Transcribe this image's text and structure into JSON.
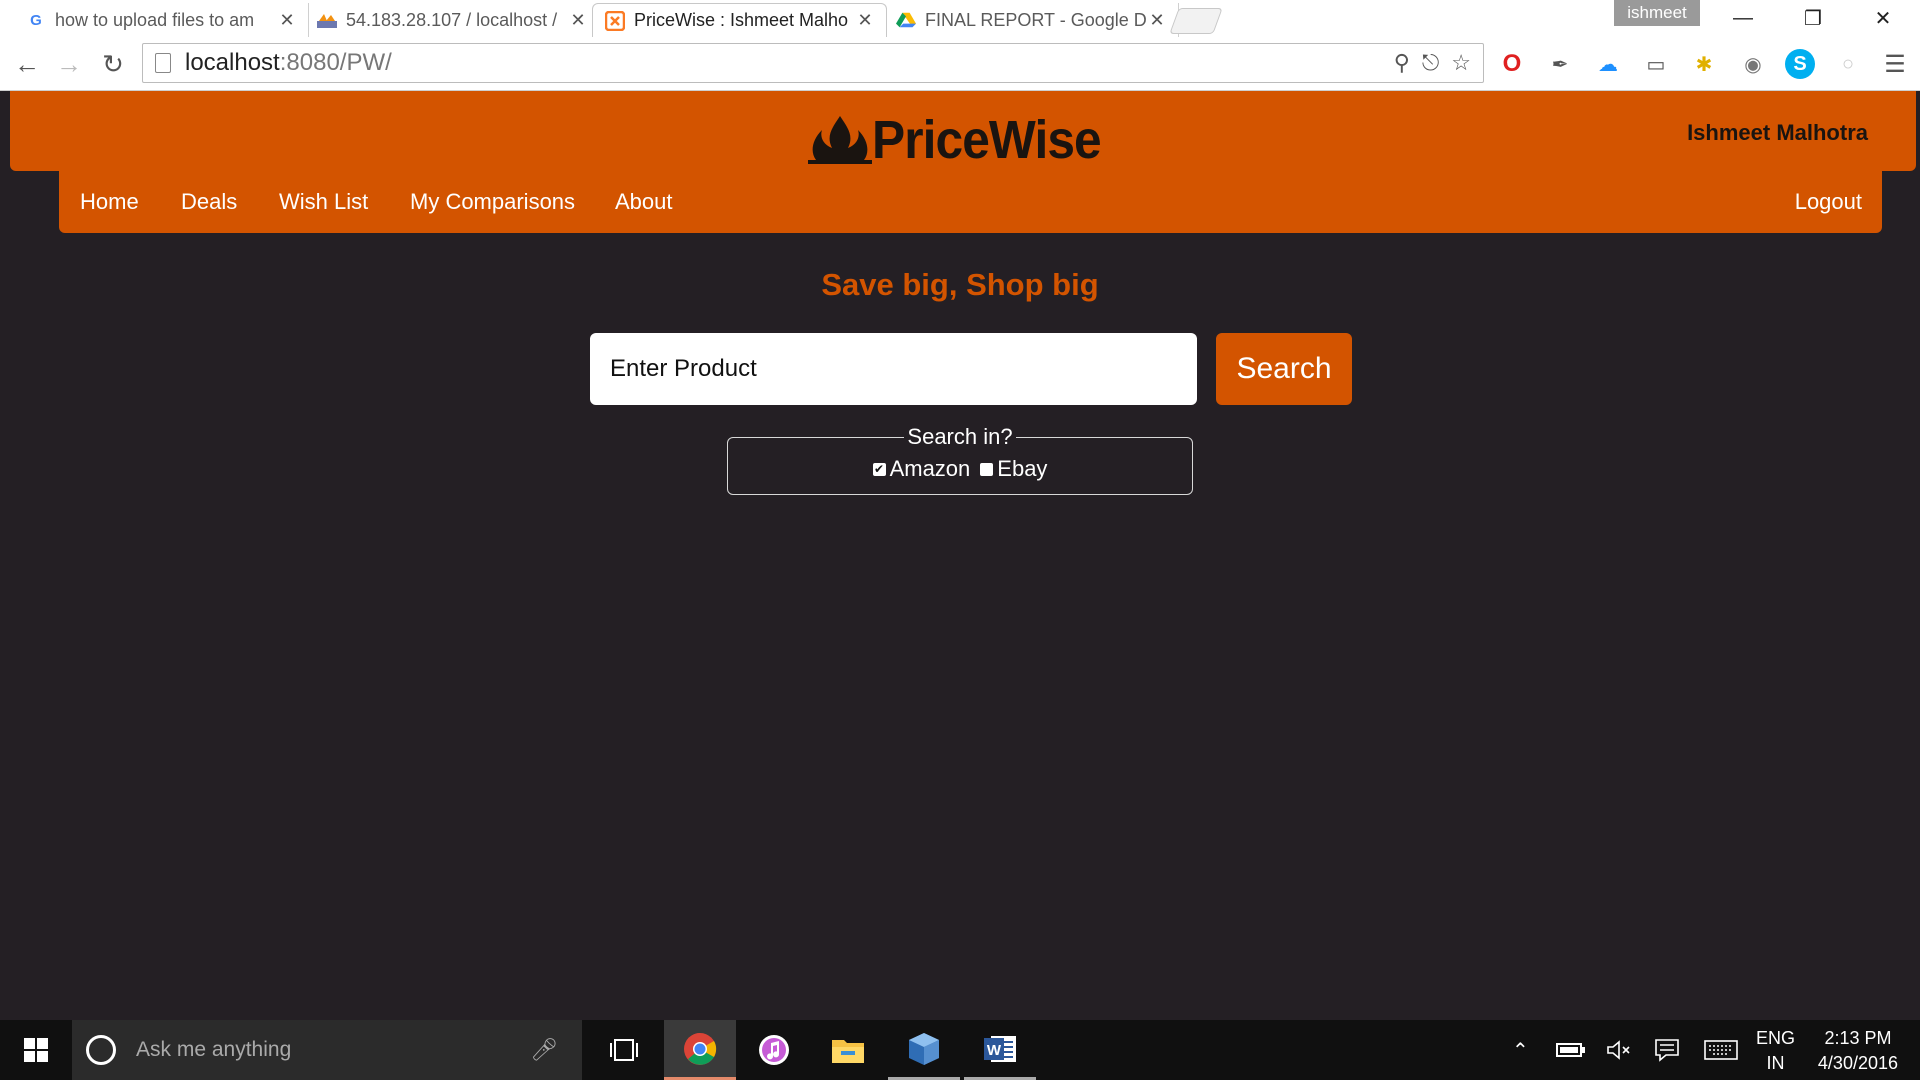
{
  "browser": {
    "tabs": [
      {
        "title": "how to upload files to am",
        "favicon": "google-g-icon",
        "active": false
      },
      {
        "title": "54.183.28.107 / localhost /",
        "favicon": "phpmyadmin-icon",
        "active": false
      },
      {
        "title": "PriceWise : Ishmeet Malho",
        "favicon": "xampp-icon",
        "active": true
      },
      {
        "title": "FINAL REPORT - Google D",
        "favicon": "google-drive-icon",
        "active": false
      }
    ],
    "profile_name": "ishmeet",
    "url_host": "localhost",
    "url_path": ":8080/PW/"
  },
  "site": {
    "logo_text": "PriceWise",
    "user_name": "Ishmeet Malhotra",
    "nav": [
      "Home",
      "Deals",
      "Wish List",
      "My Comparisons",
      "About"
    ],
    "logout_label": "Logout",
    "tagline": "Save big, Shop big",
    "search_placeholder": "Enter Product",
    "search_button": "Search",
    "search_in_legend": "Search in?",
    "sources": [
      {
        "label": "Amazon",
        "checked": true
      },
      {
        "label": "Ebay",
        "checked": false
      }
    ]
  },
  "taskbar": {
    "cortana_placeholder": "Ask me anything",
    "language_line1": "ENG",
    "language_line2": "IN",
    "time": "2:13 PM",
    "date": "4/30/2016"
  },
  "colors": {
    "brand_orange": "#d35400",
    "page_background": "#241f24"
  }
}
